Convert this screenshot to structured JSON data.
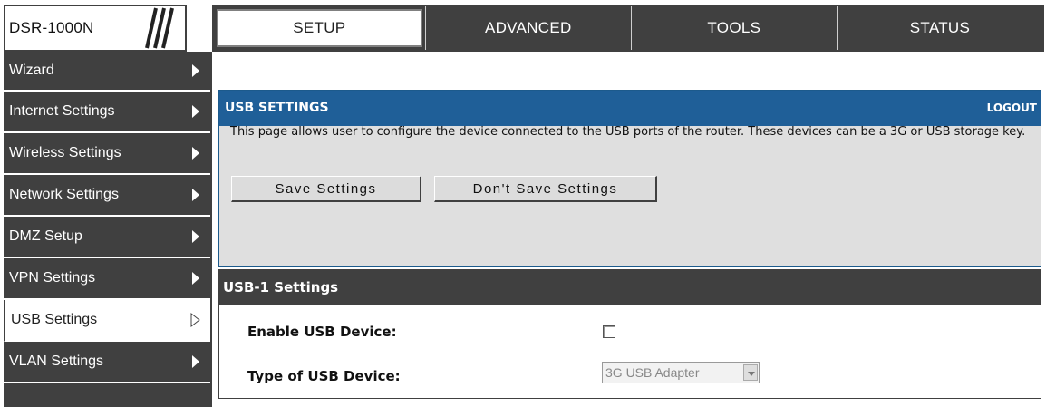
{
  "header": {
    "logo": "DSR-1000N",
    "tabs": [
      {
        "label": "SETUP",
        "active": true
      },
      {
        "label": "ADVANCED",
        "active": false
      },
      {
        "label": "TOOLS",
        "active": false
      },
      {
        "label": "STATUS",
        "active": false
      }
    ]
  },
  "sidebar": {
    "items": [
      {
        "label": "Wizard",
        "icon": "chevron-right-icon"
      },
      {
        "label": "Internet Settings",
        "icon": "chevron-right-icon"
      },
      {
        "label": "Wireless Settings",
        "icon": "chevron-right-icon"
      },
      {
        "label": "Network Settings",
        "icon": "chevron-right-icon"
      },
      {
        "label": "DMZ Setup",
        "icon": "chevron-right-icon"
      },
      {
        "label": "VPN Settings",
        "icon": "chevron-right-icon"
      },
      {
        "label": "USB Settings",
        "icon": "chevron-right-outline-icon",
        "active": true
      },
      {
        "label": "VLAN Settings",
        "icon": "chevron-right-icon"
      }
    ]
  },
  "usb_panel": {
    "title": "USB SETTINGS",
    "logout": "LOGOUT",
    "description": "This page allows user to configure the device connected to the USB ports of the router. These devices can be a 3G or USB storage key.",
    "save_button": "Save Settings",
    "dont_save_button": "Don't Save Settings"
  },
  "usb1": {
    "title": "USB-1 Settings",
    "enable_label": "Enable USB Device:",
    "enable_checked": false,
    "type_label": "Type of USB Device:",
    "type_value": "3G USB Adapter"
  },
  "colors": {
    "dark": "#404040",
    "panel_blue": "#1f5f98",
    "panel_bg": "#dfdfdf"
  }
}
